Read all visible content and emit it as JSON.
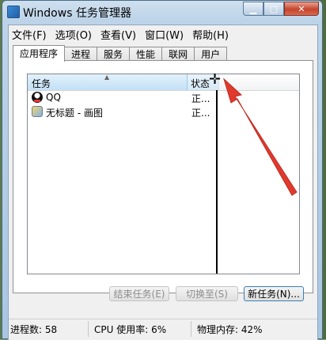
{
  "window": {
    "title": "Windows 任务管理器"
  },
  "menu": [
    "文件(F)",
    "选项(O)",
    "查看(V)",
    "窗口(W)",
    "帮助(H)"
  ],
  "tabs": [
    "应用程序",
    "进程",
    "服务",
    "性能",
    "联网",
    "用户"
  ],
  "list": {
    "columns": {
      "task": "任务",
      "status": "状态"
    },
    "rows": [
      {
        "name": "QQ",
        "status": "正...",
        "icon": "qq-icon"
      },
      {
        "name": "无标题 - 画图",
        "status": "正...",
        "icon": "paint-icon"
      }
    ]
  },
  "buttons": {
    "end_task": "结束任务(E)",
    "switch_to": "切换至(S)",
    "new_task": "新任务(N)..."
  },
  "statusbar": {
    "processes": "进程数: 58",
    "cpu": "CPU 使用率: 6%",
    "memory": "物理内存: 42%"
  },
  "colors": {
    "arrow": "#e03a2e",
    "title_bar": "#bcd3e8"
  }
}
